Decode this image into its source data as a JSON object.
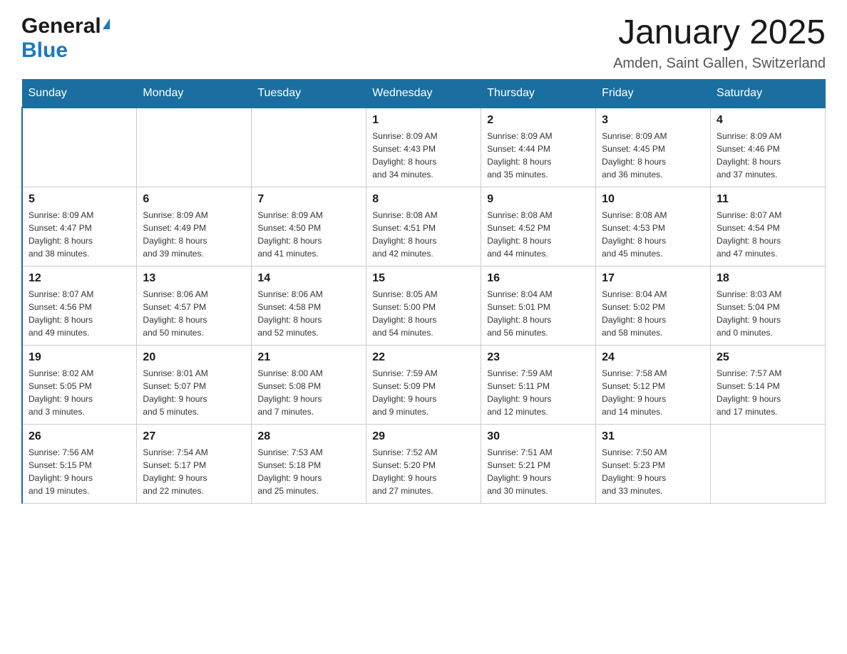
{
  "header": {
    "title": "January 2025",
    "subtitle": "Amden, Saint Gallen, Switzerland",
    "logo_general": "General",
    "logo_blue": "Blue"
  },
  "days_of_week": [
    "Sunday",
    "Monday",
    "Tuesday",
    "Wednesday",
    "Thursday",
    "Friday",
    "Saturday"
  ],
  "weeks": [
    [
      {
        "day": "",
        "info": ""
      },
      {
        "day": "",
        "info": ""
      },
      {
        "day": "",
        "info": ""
      },
      {
        "day": "1",
        "info": "Sunrise: 8:09 AM\nSunset: 4:43 PM\nDaylight: 8 hours\nand 34 minutes."
      },
      {
        "day": "2",
        "info": "Sunrise: 8:09 AM\nSunset: 4:44 PM\nDaylight: 8 hours\nand 35 minutes."
      },
      {
        "day": "3",
        "info": "Sunrise: 8:09 AM\nSunset: 4:45 PM\nDaylight: 8 hours\nand 36 minutes."
      },
      {
        "day": "4",
        "info": "Sunrise: 8:09 AM\nSunset: 4:46 PM\nDaylight: 8 hours\nand 37 minutes."
      }
    ],
    [
      {
        "day": "5",
        "info": "Sunrise: 8:09 AM\nSunset: 4:47 PM\nDaylight: 8 hours\nand 38 minutes."
      },
      {
        "day": "6",
        "info": "Sunrise: 8:09 AM\nSunset: 4:49 PM\nDaylight: 8 hours\nand 39 minutes."
      },
      {
        "day": "7",
        "info": "Sunrise: 8:09 AM\nSunset: 4:50 PM\nDaylight: 8 hours\nand 41 minutes."
      },
      {
        "day": "8",
        "info": "Sunrise: 8:08 AM\nSunset: 4:51 PM\nDaylight: 8 hours\nand 42 minutes."
      },
      {
        "day": "9",
        "info": "Sunrise: 8:08 AM\nSunset: 4:52 PM\nDaylight: 8 hours\nand 44 minutes."
      },
      {
        "day": "10",
        "info": "Sunrise: 8:08 AM\nSunset: 4:53 PM\nDaylight: 8 hours\nand 45 minutes."
      },
      {
        "day": "11",
        "info": "Sunrise: 8:07 AM\nSunset: 4:54 PM\nDaylight: 8 hours\nand 47 minutes."
      }
    ],
    [
      {
        "day": "12",
        "info": "Sunrise: 8:07 AM\nSunset: 4:56 PM\nDaylight: 8 hours\nand 49 minutes."
      },
      {
        "day": "13",
        "info": "Sunrise: 8:06 AM\nSunset: 4:57 PM\nDaylight: 8 hours\nand 50 minutes."
      },
      {
        "day": "14",
        "info": "Sunrise: 8:06 AM\nSunset: 4:58 PM\nDaylight: 8 hours\nand 52 minutes."
      },
      {
        "day": "15",
        "info": "Sunrise: 8:05 AM\nSunset: 5:00 PM\nDaylight: 8 hours\nand 54 minutes."
      },
      {
        "day": "16",
        "info": "Sunrise: 8:04 AM\nSunset: 5:01 PM\nDaylight: 8 hours\nand 56 minutes."
      },
      {
        "day": "17",
        "info": "Sunrise: 8:04 AM\nSunset: 5:02 PM\nDaylight: 8 hours\nand 58 minutes."
      },
      {
        "day": "18",
        "info": "Sunrise: 8:03 AM\nSunset: 5:04 PM\nDaylight: 9 hours\nand 0 minutes."
      }
    ],
    [
      {
        "day": "19",
        "info": "Sunrise: 8:02 AM\nSunset: 5:05 PM\nDaylight: 9 hours\nand 3 minutes."
      },
      {
        "day": "20",
        "info": "Sunrise: 8:01 AM\nSunset: 5:07 PM\nDaylight: 9 hours\nand 5 minutes."
      },
      {
        "day": "21",
        "info": "Sunrise: 8:00 AM\nSunset: 5:08 PM\nDaylight: 9 hours\nand 7 minutes."
      },
      {
        "day": "22",
        "info": "Sunrise: 7:59 AM\nSunset: 5:09 PM\nDaylight: 9 hours\nand 9 minutes."
      },
      {
        "day": "23",
        "info": "Sunrise: 7:59 AM\nSunset: 5:11 PM\nDaylight: 9 hours\nand 12 minutes."
      },
      {
        "day": "24",
        "info": "Sunrise: 7:58 AM\nSunset: 5:12 PM\nDaylight: 9 hours\nand 14 minutes."
      },
      {
        "day": "25",
        "info": "Sunrise: 7:57 AM\nSunset: 5:14 PM\nDaylight: 9 hours\nand 17 minutes."
      }
    ],
    [
      {
        "day": "26",
        "info": "Sunrise: 7:56 AM\nSunset: 5:15 PM\nDaylight: 9 hours\nand 19 minutes."
      },
      {
        "day": "27",
        "info": "Sunrise: 7:54 AM\nSunset: 5:17 PM\nDaylight: 9 hours\nand 22 minutes."
      },
      {
        "day": "28",
        "info": "Sunrise: 7:53 AM\nSunset: 5:18 PM\nDaylight: 9 hours\nand 25 minutes."
      },
      {
        "day": "29",
        "info": "Sunrise: 7:52 AM\nSunset: 5:20 PM\nDaylight: 9 hours\nand 27 minutes."
      },
      {
        "day": "30",
        "info": "Sunrise: 7:51 AM\nSunset: 5:21 PM\nDaylight: 9 hours\nand 30 minutes."
      },
      {
        "day": "31",
        "info": "Sunrise: 7:50 AM\nSunset: 5:23 PM\nDaylight: 9 hours\nand 33 minutes."
      },
      {
        "day": "",
        "info": ""
      }
    ]
  ]
}
